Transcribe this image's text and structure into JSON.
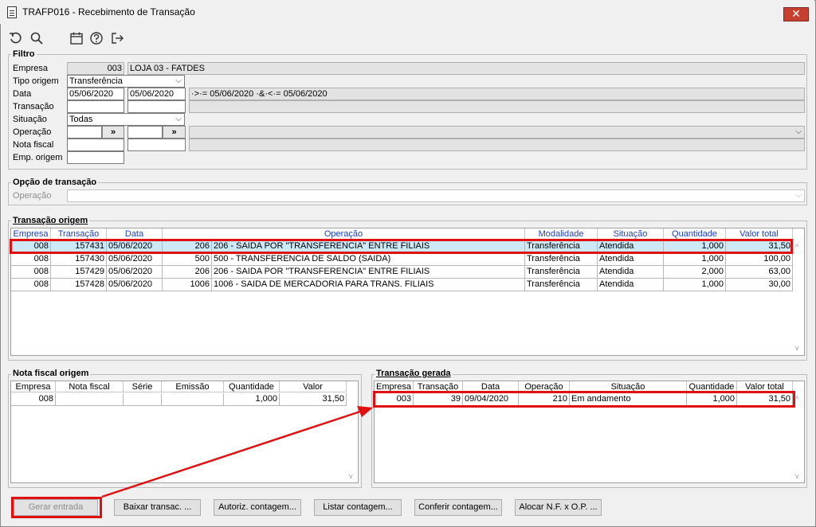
{
  "window": {
    "title": "TRAFP016 - Recebimento de Transação",
    "close_glyph": "✕"
  },
  "toolbar": {
    "icons": [
      "undo-icon",
      "search-icon",
      "calendar-icon",
      "help-icon",
      "exit-icon"
    ]
  },
  "filtro": {
    "title": "Filtro",
    "labels": {
      "empresa": "Empresa",
      "tipo_origem": "Tipo origem",
      "data": "Data",
      "transacao": "Transação",
      "situacao": "Situação",
      "operacao": "Operação",
      "nota_fiscal": "Nota fiscal",
      "emp_origem": "Emp. origem"
    },
    "empresa_code": "003",
    "empresa_name": "LOJA 03 - FATDES",
    "tipo_origem": "Transferência",
    "data_de": "05/06/2020",
    "data_ate": "05/06/2020",
    "data_desc": "·>·= 05/06/2020 ·&·<·= 05/06/2020",
    "situacao": "Todas",
    "lookup_btn": "»"
  },
  "opcao": {
    "title": "Opção de transação",
    "label_operacao": "Operação"
  },
  "origem": {
    "title": "Transação origem",
    "columns": [
      "Empresa",
      "Transação",
      "Data",
      "Operação",
      "Modalidade",
      "Situação",
      "Quantidade",
      "Valor total"
    ],
    "rows": [
      {
        "empresa": "008",
        "transacao": "157431",
        "data": "05/06/2020",
        "op_code": "206",
        "op_desc": "206 - SAIDA POR \"TRANSFERENCIA\" ENTRE FILIAIS",
        "modalidade": "Transferência",
        "situacao": "Atendida",
        "quantidade": "1,000",
        "valor": "31,50"
      },
      {
        "empresa": "008",
        "transacao": "157430",
        "data": "05/06/2020",
        "op_code": "500",
        "op_desc": "500 - TRANSFERENCIA DE SALDO (SAIDA)",
        "modalidade": "Transferência",
        "situacao": "Atendida",
        "quantidade": "1,000",
        "valor": "100,00"
      },
      {
        "empresa": "008",
        "transacao": "157429",
        "data": "05/06/2020",
        "op_code": "206",
        "op_desc": "206 - SAIDA POR \"TRANSFERENCIA\" ENTRE FILIAIS",
        "modalidade": "Transferência",
        "situacao": "Atendida",
        "quantidade": "2,000",
        "valor": "63,00"
      },
      {
        "empresa": "008",
        "transacao": "157428",
        "data": "05/06/2020",
        "op_code": "1006",
        "op_desc": "1006  - SAIDA DE MERCADORIA PARA TRANS. FILIAIS",
        "modalidade": "Transferência",
        "situacao": "Atendida",
        "quantidade": "1,000",
        "valor": "30,00"
      }
    ]
  },
  "nota": {
    "title": "Nota fiscal origem",
    "columns": [
      "Empresa",
      "Nota fiscal",
      "Série",
      "Emissão",
      "Quantidade",
      "Valor"
    ],
    "row": {
      "empresa": "008",
      "nota": "",
      "serie": "",
      "emissao": "",
      "quantidade": "1,000",
      "valor": "31,50"
    }
  },
  "gerada": {
    "title": "Transação gerada",
    "columns": [
      "Empresa",
      "Transação",
      "Data",
      "Operação",
      "Situação",
      "Quantidade",
      "Valor total"
    ],
    "row": {
      "empresa": "003",
      "transacao": "39",
      "data": "09/04/2020",
      "operacao": "210",
      "situacao": "Em andamento",
      "quantidade": "1,000",
      "valor": "31,50"
    }
  },
  "buttons": {
    "gerar": "Gerar entrada",
    "baixar": "Baixar transac. ...",
    "autoriz": "Autoriz. contagem...",
    "listar": "Listar contagem...",
    "conferir": "Conferir contagem...",
    "alocar": "Alocar N.F. x O.P. ..."
  },
  "colors": {
    "highlight": "#e01010",
    "selected_row": "#cde8f6",
    "header_text": "#1a3fbf"
  }
}
